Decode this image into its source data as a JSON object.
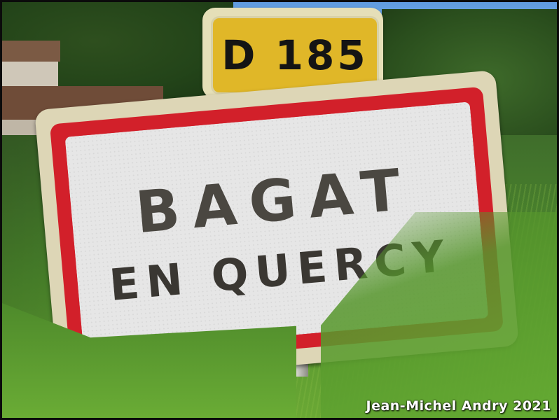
{
  "road_sign": {
    "text": "D 185"
  },
  "town_sign": {
    "line1": "BAGAT",
    "line2": "EN QUERCY"
  },
  "credit": {
    "text": "Jean-Michel Andry 2021"
  },
  "colors": {
    "sign_red": "#d2202a",
    "road_sign_yellow": "#e0b728",
    "grass": "#5a9a30",
    "sky": "#7fb1e6"
  }
}
